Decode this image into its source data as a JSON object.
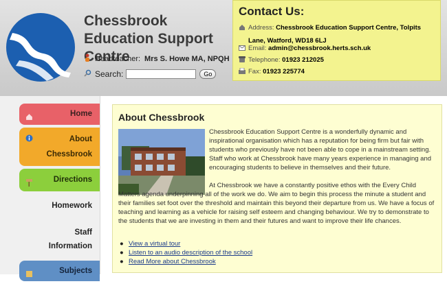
{
  "header": {
    "title": "Chessbrook Education Support Centre",
    "headteacher_label": "Headteacher:",
    "headteacher_name": "Mrs S. Howe MA, NPQH",
    "search_label": "Search:",
    "search_value": "",
    "go_label": "Go"
  },
  "contact": {
    "title": "Contact Us:",
    "address_label": "Address:",
    "address_value": "Chessbrook Education Support Centre, Tolpits Lane, Watford, WD18 6LJ",
    "email_label": "Email:",
    "email_value": "admin@chessbrook.herts.sch.uk",
    "telephone_label": "Telephone:",
    "telephone_value": "01923 212025",
    "fax_label": "Fax:",
    "fax_value": "01923 225774"
  },
  "nav": {
    "home": "Home",
    "about_line1": "About",
    "about_line2": "Chessbrook",
    "directions": "Directions",
    "homework": "Homework",
    "staff_line1": "Staff",
    "staff_line2": "Information",
    "subjects": "Subjects"
  },
  "about": {
    "title": "About Chessbrook",
    "para1": "Chessbrook Education Support Centre is a wonderfully dynamic and inspirational organisation which has a reputation for being firm but fair with students who previously have not been able to cope in a mainstream setting. Staff who work at Chessbrook have many years experience in managing and encouraging students to believe in themselves and their future.",
    "para2": "At Chessbrook we have a constantly positive ethos with the Every Child Matters agenda underpinning all of the work we do. We aim to begin this process the minute a student and their families set foot over the threshold and maintain this beyond their departure from us. We have a focus of teaching and learning as a vehicle for raising self esteem and changing behaviour. We try to demonstrate to the students that we are investing in them and their futures and want to improve their life chances.",
    "links": [
      "View a virtual tour",
      "Listen to an audio description of the school",
      "Read More about Chessbrook"
    ]
  },
  "colors": {
    "home": "#e86168",
    "about": "#f2a92a",
    "directions": "#8ccf3c",
    "subjects": "#5f8fc5",
    "contact_bg": "#f3f38f",
    "about_bg": "#fefed2"
  }
}
